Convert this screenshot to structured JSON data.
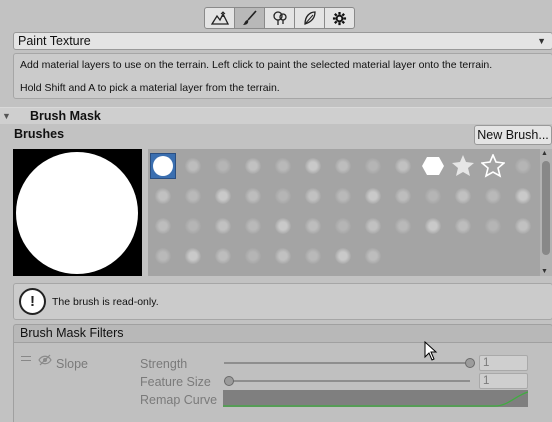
{
  "toolbar": {
    "tools": [
      {
        "icon": "raise-terrain-icon",
        "active": false
      },
      {
        "icon": "paint-brush-icon",
        "active": true
      },
      {
        "icon": "trees-icon",
        "active": false
      },
      {
        "icon": "details-icon",
        "active": false
      },
      {
        "icon": "gear-icon",
        "active": false
      }
    ]
  },
  "tool_selector": {
    "value": "Paint Texture"
  },
  "help": {
    "line1": "Add material layers to use on the terrain. Left click to paint the selected material layer onto the terrain.",
    "line2": "Hold Shift and A to pick a material layer from the terrain."
  },
  "brush_mask": {
    "title": "Brush Mask",
    "brushes_label": "Brushes",
    "new_brush_label": "New Brush...",
    "readonly_message": "The brush is read-only."
  },
  "filters": {
    "header": "Brush Mask Filters",
    "slope_label": "Slope",
    "strength_label": "Strength",
    "strength_value": "1",
    "strength_level": 1.0,
    "feature_size_label": "Feature Size",
    "feature_size_value": "1",
    "feature_size_level": 0.0,
    "remap_label": "Remap Curve",
    "curve_color": "#3fae3f"
  },
  "colors": {
    "selected_brush": "#3b6fb0",
    "panel_bg": "#c2c2c2"
  }
}
